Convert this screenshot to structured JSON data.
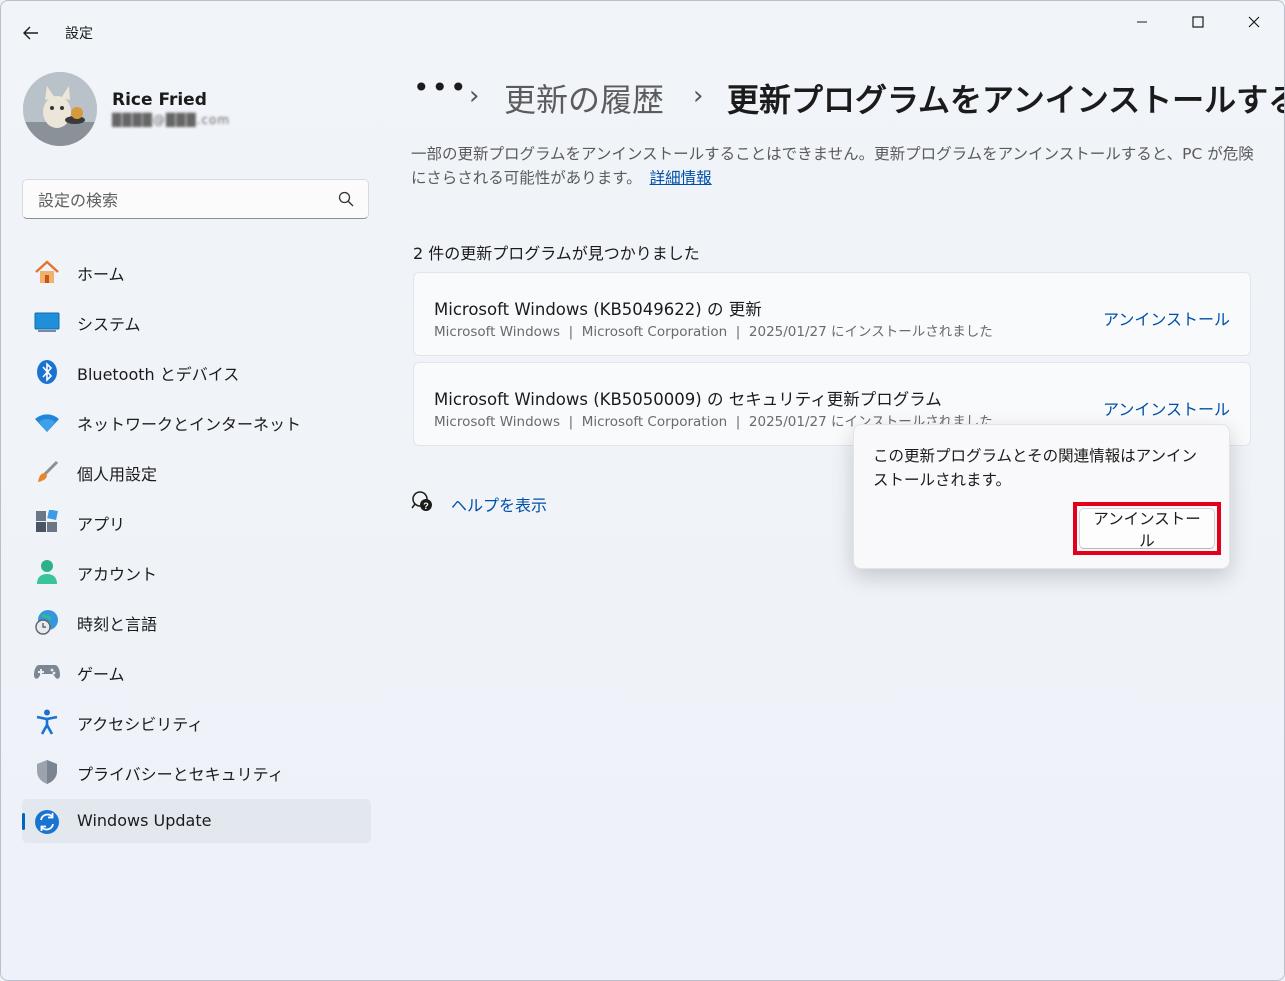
{
  "window": {
    "title": "設定"
  },
  "profile": {
    "name": "Rice Fried",
    "email": "████@███.com"
  },
  "search": {
    "placeholder": "設定の検索"
  },
  "nav": {
    "items": [
      {
        "label": "ホーム",
        "icon": "home-icon"
      },
      {
        "label": "システム",
        "icon": "system-icon"
      },
      {
        "label": "Bluetooth とデバイス",
        "icon": "bluetooth-icon"
      },
      {
        "label": "ネットワークとインターネット",
        "icon": "wifi-icon"
      },
      {
        "label": "個人用設定",
        "icon": "brush-icon"
      },
      {
        "label": "アプリ",
        "icon": "apps-icon"
      },
      {
        "label": "アカウント",
        "icon": "account-icon"
      },
      {
        "label": "時刻と言語",
        "icon": "time-language-icon"
      },
      {
        "label": "ゲーム",
        "icon": "gamepad-icon"
      },
      {
        "label": "アクセシビリティ",
        "icon": "accessibility-icon"
      },
      {
        "label": "プライバシーとセキュリティ",
        "icon": "shield-icon"
      },
      {
        "label": "Windows Update",
        "icon": "windows-update-icon",
        "active": true
      }
    ]
  },
  "breadcrumb": {
    "dots": "•••",
    "parent": "更新の履歴",
    "current": "更新プログラムをアンインストールする"
  },
  "description": {
    "text": "一部の更新プログラムをアンインストールすることはできません。更新プログラムをアンインストールすると、PC が危険にさらされる可能性があります。",
    "link": "詳細情報"
  },
  "updates": {
    "count_label": "2 件の更新プログラムが見つかりました",
    "items": [
      {
        "title": "Microsoft Windows (KB5049622) の 更新",
        "meta": "Microsoft Windows  |  Microsoft Corporation  |  2025/01/27 にインストールされました",
        "action": "アンインストール"
      },
      {
        "title": "Microsoft Windows (KB5050009) の セキュリティ更新プログラム",
        "meta": "Microsoft Windows  |  Microsoft Corporation  |  2025/01/27 にインストールされました",
        "action": "アンインストール"
      }
    ]
  },
  "help": {
    "label": "ヘルプを表示"
  },
  "flyout": {
    "message": "この更新プログラムとその関連情報はアンインストールされます。",
    "confirm": "アンインストール"
  },
  "colors": {
    "accent": "#0067c0",
    "link": "#0050a8",
    "highlight": "#e3001b"
  }
}
